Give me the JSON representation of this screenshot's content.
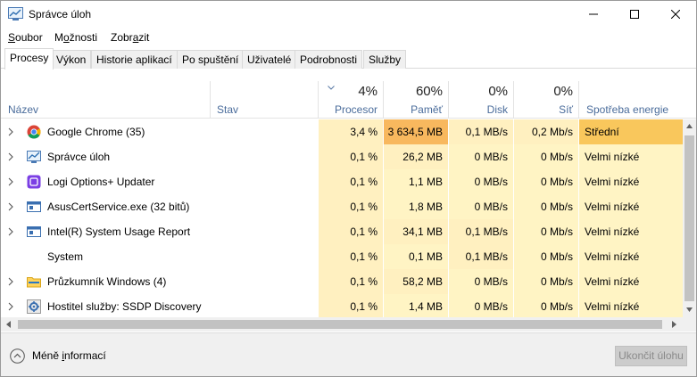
{
  "window": {
    "title": "Správce úloh"
  },
  "menu": [
    {
      "label": "Soubor",
      "accel_index": 0
    },
    {
      "label": "Možnosti",
      "accel_index": 1
    },
    {
      "label": "Zobrazit",
      "accel_index": 4
    }
  ],
  "tabs": [
    "Procesy",
    "Výkon",
    "Historie aplikací",
    "Po spuštění",
    "Uživatelé",
    "Podrobnosti",
    "Služby"
  ],
  "active_tab": "Procesy",
  "columns": {
    "name": "Název",
    "status": "Stav",
    "cpu": {
      "label": "Procesor",
      "pct": "4%"
    },
    "memory": {
      "label": "Paměť",
      "pct": "60%"
    },
    "disk": {
      "label": "Disk",
      "pct": "0%"
    },
    "network": {
      "label": "Síť",
      "pct": "0%"
    },
    "power": {
      "label": "Spotřeba energie"
    }
  },
  "processes": [
    {
      "name": "Google Chrome (35)",
      "icon": "chrome-icon",
      "expandable": true,
      "cpu": "3,4 %",
      "memory": "3 634,5 MB",
      "disk": "0,1 MB/s",
      "network": "0,2 Mb/s",
      "power": "Střední",
      "mem_heat": "#f8b85e",
      "disk_heat": "#fff0c0",
      "net_heat": "#fff0c0",
      "power_heat": "#f9c75c"
    },
    {
      "name": "Správce úloh",
      "icon": "task-manager-icon",
      "expandable": true,
      "cpu": "0,1 %",
      "memory": "26,2 MB",
      "disk": "0 MB/s",
      "network": "0 Mb/s",
      "power": "Velmi nízké",
      "mem_heat": "#fff0c0",
      "disk_heat": "#fff4c4",
      "net_heat": "#fff4c4",
      "power_heat": "#fff4c4"
    },
    {
      "name": "Logi Options+ Updater",
      "icon": "logi-icon",
      "expandable": true,
      "cpu": "0,1 %",
      "memory": "1,1 MB",
      "disk": "0 MB/s",
      "network": "0 Mb/s",
      "power": "Velmi nízké",
      "mem_heat": "#fff4c4",
      "disk_heat": "#fff4c4",
      "net_heat": "#fff4c4",
      "power_heat": "#fff4c4"
    },
    {
      "name": "AsusCertService.exe (32 bitů)",
      "icon": "service-window-icon",
      "expandable": true,
      "cpu": "0,1 %",
      "memory": "1,8 MB",
      "disk": "0 MB/s",
      "network": "0 Mb/s",
      "power": "Velmi nízké",
      "mem_heat": "#fff4c4",
      "disk_heat": "#fff4c4",
      "net_heat": "#fff4c4",
      "power_heat": "#fff4c4"
    },
    {
      "name": "Intel(R) System Usage Report",
      "icon": "service-window-icon",
      "expandable": true,
      "cpu": "0,1 %",
      "memory": "34,1 MB",
      "disk": "0,1 MB/s",
      "network": "0 Mb/s",
      "power": "Velmi nízké",
      "mem_heat": "#fff0c0",
      "disk_heat": "#fff0c0",
      "net_heat": "#fff4c4",
      "power_heat": "#fff4c4"
    },
    {
      "name": "System",
      "icon": "system-icon",
      "expandable": false,
      "cpu": "0,1 %",
      "memory": "0,1 MB",
      "disk": "0,1 MB/s",
      "network": "0 Mb/s",
      "power": "Velmi nízké",
      "mem_heat": "#fff4c4",
      "disk_heat": "#fff0c0",
      "net_heat": "#fff4c4",
      "power_heat": "#fff4c4"
    },
    {
      "name": "Průzkumník Windows (4)",
      "icon": "explorer-folder-icon",
      "expandable": true,
      "cpu": "0,1 %",
      "memory": "58,2 MB",
      "disk": "0 MB/s",
      "network": "0 Mb/s",
      "power": "Velmi nízké",
      "mem_heat": "#fff0c0",
      "disk_heat": "#fff4c4",
      "net_heat": "#fff4c4",
      "power_heat": "#fff4c4"
    },
    {
      "name": "Hostitel služby: SSDP Discovery",
      "icon": "gear-service-icon",
      "expandable": true,
      "cpu": "0,1 %",
      "memory": "1,4 MB",
      "disk": "0 MB/s",
      "network": "0 Mb/s",
      "power": "Velmi nízké",
      "mem_heat": "#fff4c4",
      "disk_heat": "#fff4c4",
      "net_heat": "#fff4c4",
      "power_heat": "#fff4c4"
    }
  ],
  "cpu_heat": "#fff0c0",
  "footer": {
    "less_details": "Méně informací",
    "end_task": "Ukončit úlohu"
  }
}
